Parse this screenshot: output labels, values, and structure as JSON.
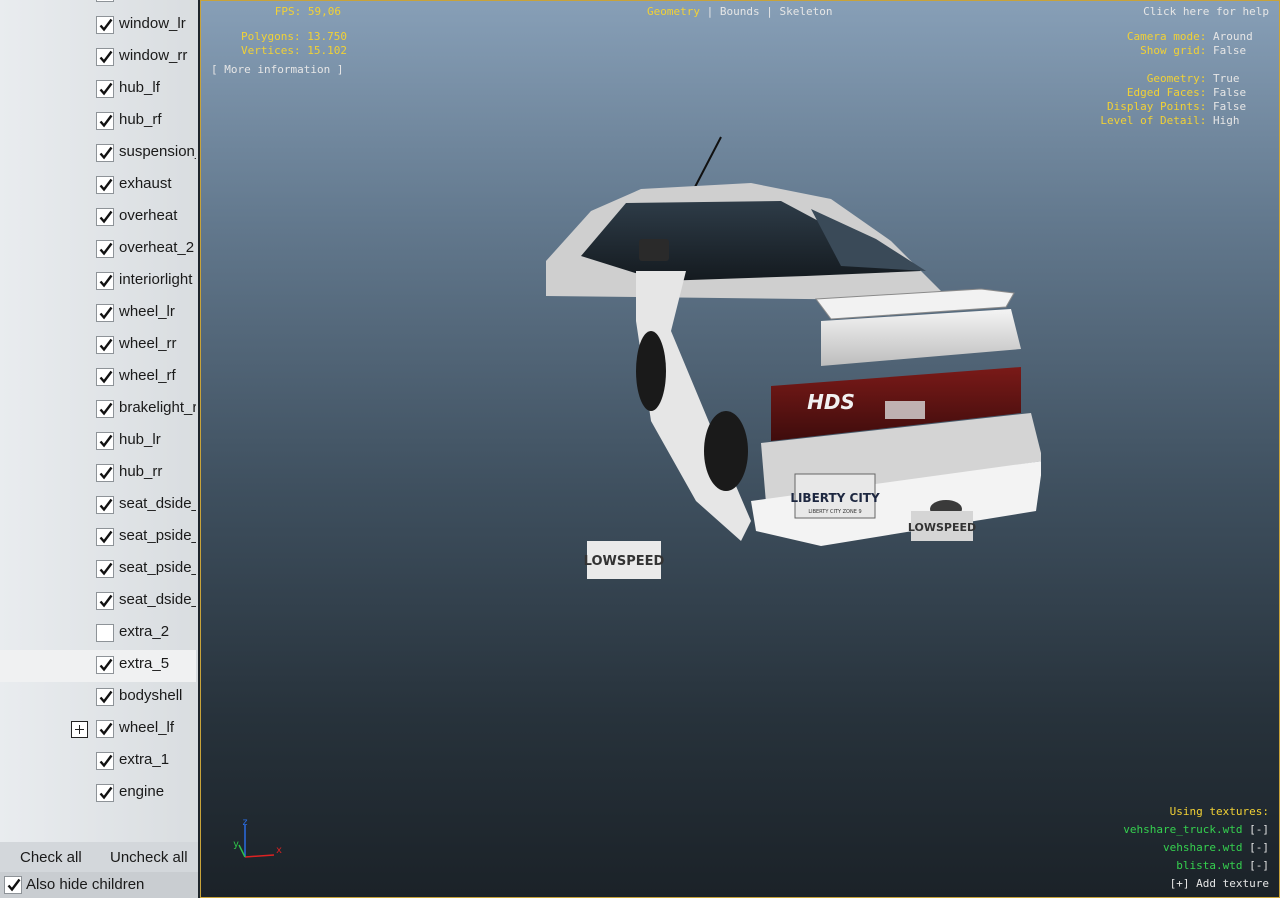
{
  "tree": {
    "items": [
      {
        "label": "window_lr",
        "checked": true
      },
      {
        "label": "window_rr",
        "checked": true
      },
      {
        "label": "hub_lf",
        "checked": true
      },
      {
        "label": "hub_rf",
        "checked": true
      },
      {
        "label": "suspension_",
        "checked": true
      },
      {
        "label": "exhaust",
        "checked": true
      },
      {
        "label": "overheat",
        "checked": true
      },
      {
        "label": "overheat_2",
        "checked": true
      },
      {
        "label": "interiorlight",
        "checked": true
      },
      {
        "label": "wheel_lr",
        "checked": true
      },
      {
        "label": "wheel_rr",
        "checked": true
      },
      {
        "label": "wheel_rf",
        "checked": true
      },
      {
        "label": "brakelight_r",
        "checked": true
      },
      {
        "label": "hub_lr",
        "checked": true
      },
      {
        "label": "hub_rr",
        "checked": true
      },
      {
        "label": "seat_dside_",
        "checked": true
      },
      {
        "label": "seat_pside_",
        "checked": true
      },
      {
        "label": "seat_pside_",
        "checked": true
      },
      {
        "label": "seat_dside_",
        "checked": true
      },
      {
        "label": "extra_2",
        "checked": false
      },
      {
        "label": "extra_5",
        "checked": true,
        "selected": true
      },
      {
        "label": "bodyshell",
        "checked": true
      },
      {
        "label": "wheel_lf",
        "checked": true,
        "expandable": true
      },
      {
        "label": "extra_1",
        "checked": true
      },
      {
        "label": "engine",
        "checked": true
      }
    ]
  },
  "buttons": {
    "check_all": "Check all",
    "uncheck_all": "Uncheck all"
  },
  "also_hide_children": {
    "label": "Also hide children",
    "checked": true
  },
  "hud": {
    "fps_label": "FPS:",
    "fps_value": "59,06",
    "polygons_label": "Polygons:",
    "polygons_value": "13.750",
    "vertices_label": "Vertices:",
    "vertices_value": "15.102",
    "more_info": "[ More information ]",
    "modes": [
      "Geometry",
      "Bounds",
      "Skeleton"
    ],
    "separator": "|",
    "help": "Click here for help",
    "settings": [
      {
        "label": "Camera mode:",
        "value": "Around"
      },
      {
        "label": "Show grid:",
        "value": "False"
      },
      {
        "label": "Geometry:",
        "value": "True"
      },
      {
        "label": "Edged Faces:",
        "value": "False"
      },
      {
        "label": "Display Points:",
        "value": "False"
      },
      {
        "label": "Level of Detail:",
        "value": "High"
      }
    ],
    "textures_label": "Using textures:",
    "textures": [
      {
        "name": "vehshare_truck.wtd",
        "action": "[-]"
      },
      {
        "name": "vehshare.wtd",
        "action": "[-]"
      },
      {
        "name": "blista.wtd",
        "action": "[-]"
      }
    ],
    "add_texture": "[+] Add texture",
    "axis": {
      "x": "x",
      "y": "y",
      "z": "z"
    }
  },
  "car": {
    "brand_badge": "HDS",
    "plate": "LIBERTY CITY",
    "plate_sub": "LIBERTY CITY ZONE 9",
    "flap_text": "LOWSPEED"
  },
  "colors": {
    "hud_yellow": "#f1d135",
    "hud_white": "#e6e6e6",
    "hud_green": "#35d14f",
    "border": "#c8a33a"
  }
}
